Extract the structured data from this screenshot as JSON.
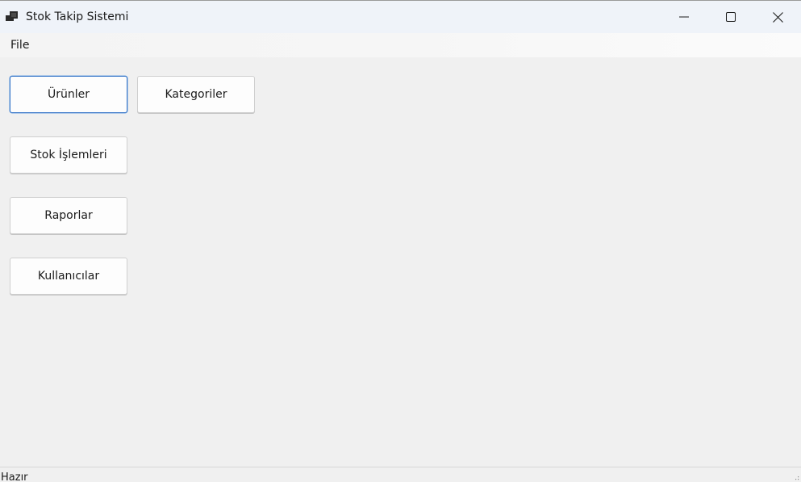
{
  "window": {
    "title": "Stok Takip Sistemi",
    "app_icon": "app-window-icon",
    "controls": [
      "minimize-icon",
      "maximize-icon",
      "close-icon"
    ]
  },
  "menu": {
    "items": [
      {
        "label": "File"
      }
    ]
  },
  "main": {
    "buttons": [
      {
        "label": "Ürünler",
        "focused": true
      },
      {
        "label": "Kategoriler"
      },
      {
        "label": "Stok İşlemleri"
      },
      {
        "label": "Raporlar"
      },
      {
        "label": "Kullanıcılar"
      }
    ]
  },
  "status": {
    "text": "Hazır"
  }
}
